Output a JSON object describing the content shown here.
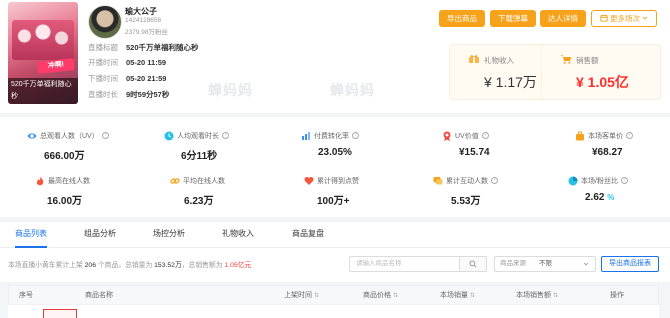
{
  "cover": {
    "banner_text": "冲啊!",
    "title": "520千万单福利随心秒"
  },
  "anchor": {
    "name": "瑜大公子",
    "id": "1424128656",
    "fans": "2379.98万粉丝"
  },
  "live_info": [
    {
      "label": "直播标题",
      "value": "520千万单福利随心秒",
      "bold": true
    },
    {
      "label": "开播时间",
      "value": "05-20 11:59",
      "bold": true
    },
    {
      "label": "下播时间",
      "value": "05-20 21:59",
      "bold": true
    },
    {
      "label": "直播时长",
      "value": "9时59分57秒",
      "bold": true
    }
  ],
  "actions": {
    "export_goods": "导出商品",
    "download_barrage": "下载弹幕",
    "anchor_detail": "达人详情",
    "more_sessions": "更多场次"
  },
  "money": {
    "gift_income": {
      "label": "礼物收入",
      "value": "¥ 1.17万"
    },
    "sales_amount": {
      "label": "销售额",
      "value": "¥ 1.05亿"
    }
  },
  "watermark": "蝉妈妈",
  "metrics": [
    {
      "label": "总观看人数（UV）",
      "value": "666.00万",
      "icon": "eye-icon",
      "help": true
    },
    {
      "label": "人均观看时长",
      "value": "6分11秒",
      "icon": "clock-icon",
      "help": true
    },
    {
      "label": "付费转化率",
      "value": "23.05%",
      "icon": "chart-icon",
      "help": true
    },
    {
      "label": "UV价值",
      "value": "¥15.74",
      "icon": "medal-icon",
      "help": true
    },
    {
      "label": "本场客单价",
      "value": "¥68.27",
      "icon": "box-icon",
      "help": true
    },
    {
      "label": "最高在线人数",
      "value": "16.00万",
      "icon": "flame-icon",
      "help": false
    },
    {
      "label": "平均在线人数",
      "value": "6.23万",
      "icon": "link-icon",
      "help": false
    },
    {
      "label": "累计得到点赞",
      "value": "100万+",
      "icon": "heart-icon",
      "help": false
    },
    {
      "label": "累计互动人数",
      "value": "5.53万",
      "icon": "chat-icon",
      "help": true
    },
    {
      "label": "本场/粉丝比",
      "value": "2.62",
      "value_suffix": "%",
      "icon": "pie-icon",
      "help": true
    }
  ],
  "tabs": [
    {
      "label": "商品列表",
      "active": true
    },
    {
      "label": "组品分析",
      "active": false
    },
    {
      "label": "场控分析",
      "active": false
    },
    {
      "label": "礼物收入",
      "active": false
    },
    {
      "label": "商品复盘",
      "active": false
    }
  ],
  "summary": {
    "t1": "本场直播小黄车累计上架",
    "count": "206",
    "t2": "个商品，总销量为",
    "volume": "153.52万",
    "t3": "，总销售额为",
    "amount": "1.05亿元"
  },
  "search": {
    "placeholder": "请输入商品名称"
  },
  "source_filter": {
    "label": "商品来源",
    "value": "不限"
  },
  "export_table": "导出商品报表",
  "table_headers": [
    {
      "label": "序号",
      "sortable": false
    },
    {
      "label": "商品名称",
      "sortable": false
    },
    {
      "label": "上架时间",
      "sortable": true
    },
    {
      "label": "商品价格",
      "sortable": true
    },
    {
      "label": "本场销量",
      "sortable": true
    },
    {
      "label": "本场销售额",
      "sortable": true
    },
    {
      "label": "操作",
      "sortable": false
    }
  ],
  "colors": {
    "accent": "#f7a21b",
    "link": "#1a73e8",
    "red": "#ff2d2d"
  }
}
